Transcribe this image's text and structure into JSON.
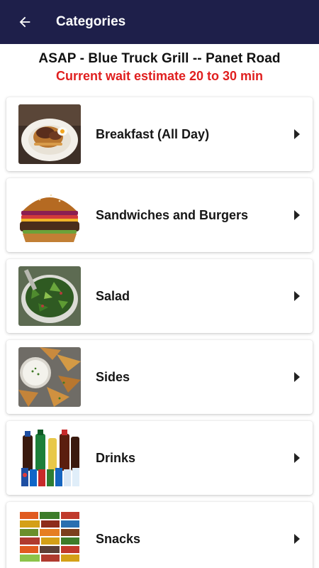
{
  "appbar": {
    "title": "Categories",
    "back_icon": "arrow-left-icon",
    "background": "#1e1f4a"
  },
  "restaurant": {
    "name": "ASAP - Blue Truck Grill -- Panet Road",
    "wait_text": "Current wait estimate 20 to 30 min",
    "wait_color": "#e01f1f"
  },
  "categories": [
    {
      "label": "Breakfast (All Day)",
      "image": "breakfast-image"
    },
    {
      "label": "Sandwiches and Burgers",
      "image": "burger-image"
    },
    {
      "label": "Salad",
      "image": "salad-image"
    },
    {
      "label": "Sides",
      "image": "sides-image"
    },
    {
      "label": "Drinks",
      "image": "drinks-image"
    },
    {
      "label": "Snacks",
      "image": "snacks-image"
    }
  ]
}
